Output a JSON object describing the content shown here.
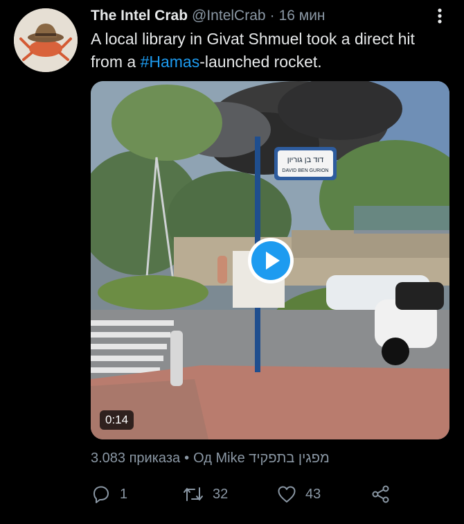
{
  "tweet": {
    "author_name": "The Intel Crab",
    "handle": "@IntelCrab",
    "separator": "·",
    "time": "16 мин",
    "text_before": "A local library in Givat Shmuel took a direct hit from a ",
    "hashtag": "#Hamas",
    "text_after": "-launched rocket.",
    "media": {
      "duration": "0:14",
      "sign_line1": "דוד בן גוריון",
      "sign_line2": "DAVID BEN GURION"
    },
    "context": {
      "views": "3.083 приказа",
      "separator": "•",
      "source": "Од Mike מפגין בתפקיד"
    },
    "actions": {
      "reply_count": "1",
      "retweet_count": "32",
      "like_count": "43"
    }
  },
  "colors": {
    "background": "#000000",
    "text": "#e7e9ea",
    "secondary": "#8b98a5",
    "accent": "#1d9bf0"
  },
  "icons": {
    "more": "more-vertical-icon",
    "reply": "reply-icon",
    "retweet": "retweet-icon",
    "like": "heart-icon",
    "share": "share-icon",
    "play": "play-icon"
  }
}
